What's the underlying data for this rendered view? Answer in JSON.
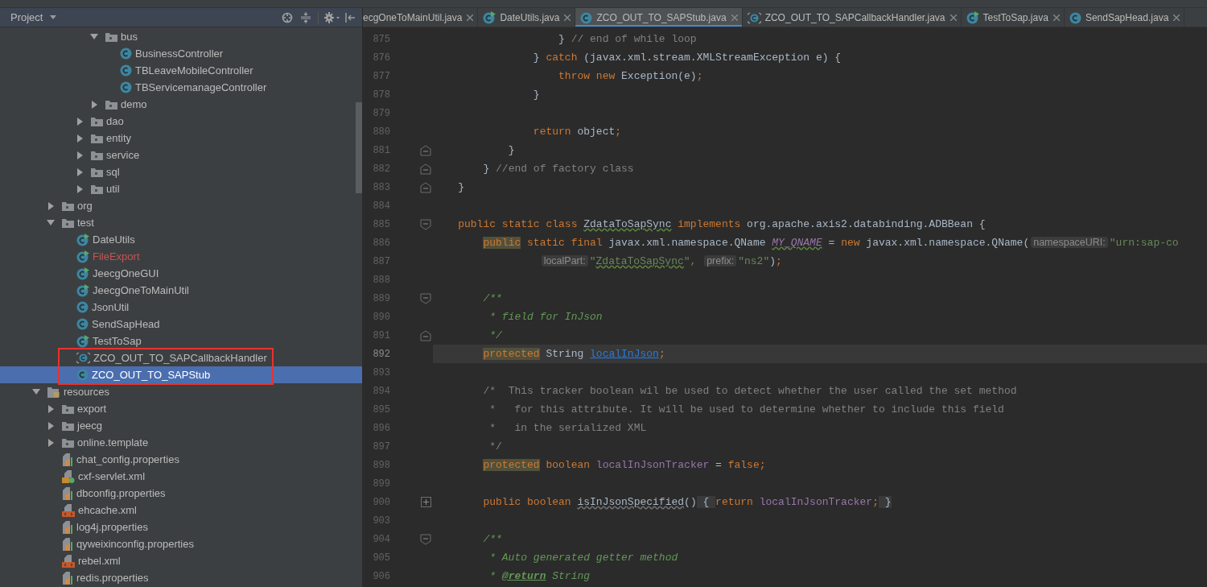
{
  "project_panel": {
    "title": "Project",
    "tree": [
      {
        "children": [
          {
            "children": [
              {
                "children": [
                  {
                    "children": [
                      {
                        "label": "bus",
                        "kind": "folder",
                        "expanded": true,
                        "selected": false,
                        "children": [
                          {
                            "label": "BusinessController",
                            "kind": "class",
                            "selected": false
                          },
                          {
                            "label": "TBLeaveMobileController",
                            "kind": "class",
                            "selected": false
                          },
                          {
                            "label": "TBServicemanageController",
                            "kind": "class",
                            "selected": false
                          }
                        ]
                      },
                      {
                        "label": "demo",
                        "kind": "folder",
                        "expanded": false,
                        "selected": false
                      }
                    ]
                  },
                  {
                    "label": "dao",
                    "kind": "folder",
                    "expanded": false,
                    "selected": false
                  },
                  {
                    "label": "entity",
                    "kind": "folder",
                    "expanded": false,
                    "selected": false
                  },
                  {
                    "label": "service",
                    "kind": "folder",
                    "expanded": false,
                    "selected": false
                  },
                  {
                    "label": "sql",
                    "kind": "folder",
                    "expanded": false,
                    "selected": false
                  },
                  {
                    "label": "util",
                    "kind": "folder",
                    "expanded": false,
                    "selected": false
                  }
                ]
              }
            ]
          },
          {
            "label": "org",
            "kind": "folder",
            "expanded": false,
            "selected": false
          },
          {
            "label": "test",
            "kind": "folder",
            "expanded": true,
            "selected": false,
            "children": [
              {
                "label": "DateUtils",
                "kind": "class-run",
                "selected": false,
                "highlighted": false
              },
              {
                "label": "FileExport",
                "kind": "class-run",
                "selected": false,
                "highlighted": false,
                "color": "#c75450"
              },
              {
                "label": "JeecgOneGUI",
                "kind": "class-run",
                "selected": false,
                "highlighted": false
              },
              {
                "label": "JeecgOneToMainUtil",
                "kind": "class-run",
                "selected": false,
                "highlighted": false
              },
              {
                "label": "JsonUtil",
                "kind": "class",
                "selected": false,
                "highlighted": false
              },
              {
                "label": "SendSapHead",
                "kind": "class",
                "selected": false,
                "highlighted": false
              },
              {
                "label": "TestToSap",
                "kind": "class-run",
                "selected": false,
                "highlighted": false
              },
              {
                "label": "ZCO_OUT_TO_SAPCallbackHandler",
                "kind": "class-plain",
                "selected": false,
                "highlighted": true
              },
              {
                "label": "ZCO_OUT_TO_SAPStub",
                "kind": "class",
                "selected": true,
                "highlighted": true
              }
            ]
          }
        ]
      },
      {
        "label": "resources",
        "kind": "resources-folder",
        "expanded": true,
        "selected": false,
        "children": [
          {
            "label": "export",
            "kind": "folder",
            "expanded": false,
            "selected": false
          },
          {
            "label": "jeecg",
            "kind": "folder",
            "expanded": false,
            "selected": false
          },
          {
            "label": "online.template",
            "kind": "folder",
            "expanded": false,
            "selected": false
          },
          {
            "label": "chat_config.properties",
            "kind": "properties",
            "selected": false
          },
          {
            "label": "cxf-servlet.xml",
            "kind": "xml-spring",
            "selected": false
          },
          {
            "label": "dbconfig.properties",
            "kind": "properties",
            "selected": false
          },
          {
            "label": "ehcache.xml",
            "kind": "xml",
            "selected": false
          },
          {
            "label": "log4j.properties",
            "kind": "properties",
            "selected": false
          },
          {
            "label": "qyweixinconfig.properties",
            "kind": "properties",
            "selected": false
          },
          {
            "label": "rebel.xml",
            "kind": "xml",
            "selected": false
          },
          {
            "label": "redis.properties",
            "kind": "properties",
            "selected": false
          }
        ]
      }
    ]
  },
  "editor": {
    "tabs": [
      {
        "label": "ecgOneToMainUtil.java",
        "kind": "none",
        "selected": false
      },
      {
        "label": "DateUtils.java",
        "kind": "class-run",
        "selected": false
      },
      {
        "label": "ZCO_OUT_TO_SAPStub.java",
        "kind": "class",
        "selected": true
      },
      {
        "label": "ZCO_OUT_TO_SAPCallbackHandler.java",
        "kind": "class-plain",
        "selected": false
      },
      {
        "label": "TestToSap.java",
        "kind": "class-run",
        "selected": false
      },
      {
        "label": "SendSapHead.java",
        "kind": "class",
        "selected": false
      }
    ],
    "lines": [
      {
        "number": "875",
        "current": false,
        "tokens": [
          {
            "kind": "plain",
            "text": "                    } "
          },
          {
            "kind": "comment",
            "text": "// end of while loop"
          }
        ]
      },
      {
        "number": "876",
        "current": false,
        "tokens": [
          {
            "kind": "plain",
            "text": "                } "
          },
          {
            "kind": "kw",
            "text": "catch "
          },
          {
            "kind": "plain",
            "text": "(javax.xml.stream.XMLStreamException e) {"
          }
        ]
      },
      {
        "number": "877",
        "current": false,
        "tokens": [
          {
            "kind": "kw",
            "text": "                    throw new "
          },
          {
            "kind": "plain",
            "text": "Exception(e)"
          },
          {
            "kind": "kw",
            "text": ";"
          }
        ]
      },
      {
        "number": "878",
        "current": false,
        "tokens": [
          {
            "kind": "plain",
            "text": "                }"
          }
        ]
      },
      {
        "number": "879",
        "current": false
      },
      {
        "number": "880",
        "current": false,
        "tokens": [
          {
            "kind": "kw",
            "text": "                return "
          },
          {
            "kind": "plain",
            "text": "object"
          },
          {
            "kind": "kw",
            "text": ";"
          }
        ]
      },
      {
        "number": "881",
        "current": false,
        "fold": {
          "kind": "end"
        },
        "tokens": [
          {
            "kind": "plain",
            "text": "            }"
          }
        ]
      },
      {
        "number": "882",
        "current": false,
        "fold": {
          "kind": "end"
        },
        "tokens": [
          {
            "kind": "plain",
            "text": "        } "
          },
          {
            "kind": "comment",
            "text": "//end of factory class"
          }
        ]
      },
      {
        "number": "883",
        "current": false,
        "fold": {
          "kind": "end"
        },
        "tokens": [
          {
            "kind": "plain",
            "text": "    }"
          }
        ]
      },
      {
        "number": "884",
        "current": false
      },
      {
        "number": "885",
        "current": false,
        "fold": {
          "kind": "start"
        },
        "tokens": [
          {
            "kind": "kw",
            "text": "    public static class "
          },
          {
            "kind": "typo",
            "text": "ZdataToSapSync"
          },
          {
            "kind": "kw",
            "text": " implements "
          },
          {
            "kind": "plain",
            "text": "org.apache.axis2.databinding.ADBBean {"
          }
        ]
      },
      {
        "number": "886",
        "current": false,
        "tokens": [
          {
            "kind": "kw-marked",
            "text": "        public"
          },
          {
            "kind": "kw",
            "text": " static final "
          },
          {
            "kind": "plain",
            "text": "javax.xml.namespace.QName "
          },
          {
            "kind": "const",
            "text": "MY_QNAME"
          },
          {
            "kind": "plain",
            "text": " = "
          },
          {
            "kind": "kw",
            "text": "new "
          },
          {
            "kind": "plain",
            "text": "javax.xml.namespace.QName("
          },
          {
            "kind": "hint",
            "text": "namespaceURI:"
          },
          {
            "kind": "string",
            "text": "\"urn:sap-co"
          }
        ]
      },
      {
        "number": "887",
        "current": false,
        "tokens": [
          {
            "kind": "hint",
            "text": "                 localPart:"
          },
          {
            "kind": "string",
            "text": "\""
          },
          {
            "kind": "string-typo",
            "text": "ZdataToSapSync"
          },
          {
            "kind": "string",
            "text": "\", "
          },
          {
            "kind": "hint",
            "text": "prefix:"
          },
          {
            "kind": "string",
            "text": "\"ns2\""
          },
          {
            "kind": "plain",
            "text": ")"
          },
          {
            "kind": "kw",
            "text": ";"
          }
        ]
      },
      {
        "number": "888",
        "current": false
      },
      {
        "number": "889",
        "current": false,
        "fold": {
          "kind": "start"
        },
        "tokens": [
          {
            "kind": "doc",
            "text": "        /**"
          }
        ]
      },
      {
        "number": "890",
        "current": false,
        "tokens": [
          {
            "kind": "doc",
            "text": "         * field for InJson"
          }
        ]
      },
      {
        "number": "891",
        "current": false,
        "fold": {
          "kind": "end"
        },
        "tokens": [
          {
            "kind": "doc",
            "text": "         */"
          }
        ]
      },
      {
        "number": "892",
        "current": true,
        "tokens": [
          {
            "kind": "kw-marked",
            "text": "        protected"
          },
          {
            "kind": "plain",
            "text": " String "
          },
          {
            "kind": "link",
            "text": "localInJson"
          },
          {
            "kind": "kw",
            "text": ";"
          }
        ]
      },
      {
        "number": "893",
        "current": false
      },
      {
        "number": "894",
        "current": false,
        "tokens": [
          {
            "kind": "comment",
            "text": "        /*  This tracker boolean wil be used to detect whether the user called the set method"
          }
        ]
      },
      {
        "number": "895",
        "current": false,
        "tokens": [
          {
            "kind": "comment",
            "text": "         *   for this attribute. It will be used to determine whether to include this field"
          }
        ]
      },
      {
        "number": "896",
        "current": false,
        "tokens": [
          {
            "kind": "comment",
            "text": "         *   in the serialized XML"
          }
        ]
      },
      {
        "number": "897",
        "current": false,
        "tokens": [
          {
            "kind": "comment",
            "text": "         */"
          }
        ]
      },
      {
        "number": "898",
        "current": false,
        "tokens": [
          {
            "kind": "kw-marked",
            "text": "        protected"
          },
          {
            "kind": "kw",
            "text": " boolean "
          },
          {
            "kind": "field",
            "text": "localInJsonTracker"
          },
          {
            "kind": "plain",
            "text": " = "
          },
          {
            "kind": "kw",
            "text": "false;"
          }
        ]
      },
      {
        "number": "899",
        "current": false
      },
      {
        "number": "900",
        "current": false,
        "fold": {
          "kind": "collapsed"
        },
        "tokens": [
          {
            "kind": "kw",
            "text": "        public boolean "
          },
          {
            "kind": "method-typo",
            "text": "isInJsonSpecified"
          },
          {
            "kind": "plain",
            "text": "()"
          },
          {
            "kind": "fold-box",
            "text": " { "
          },
          {
            "kind": "kw",
            "text": "return "
          },
          {
            "kind": "field",
            "text": "localInJsonTracker"
          },
          {
            "kind": "kw",
            "text": ";"
          },
          {
            "kind": "fold-box",
            "text": " }"
          }
        ]
      },
      {
        "number": "903",
        "current": false
      },
      {
        "number": "904",
        "current": false,
        "fold": {
          "kind": "start"
        },
        "tokens": [
          {
            "kind": "doc",
            "text": "        /**"
          }
        ]
      },
      {
        "number": "905",
        "current": false,
        "tokens": [
          {
            "kind": "doc",
            "text": "         * Auto generated getter method"
          }
        ]
      },
      {
        "number": "906",
        "current": false,
        "tokens": [
          {
            "kind": "doc",
            "text": "         * "
          },
          {
            "kind": "doc-tag",
            "text": "@return"
          },
          {
            "kind": "doc",
            "text": " String"
          }
        ]
      }
    ]
  }
}
